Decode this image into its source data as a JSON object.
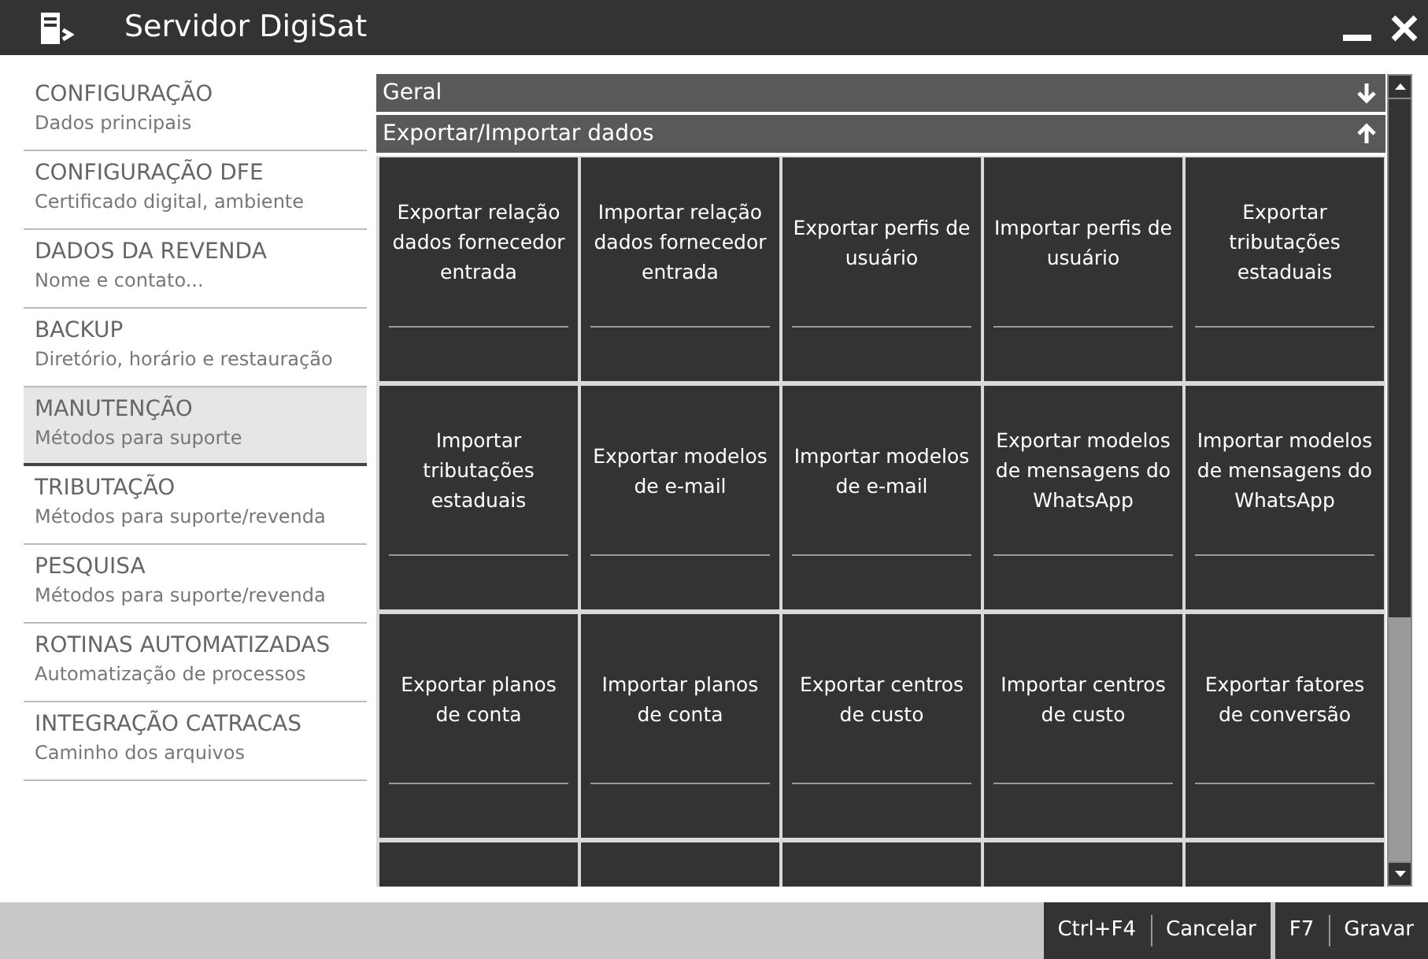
{
  "window": {
    "title": "Servidor DigiSat"
  },
  "sidebar": {
    "items": [
      {
        "title": "CONFIGURAÇÃO",
        "subtitle": "Dados principais",
        "selected": false
      },
      {
        "title": "CONFIGURAÇÃO DFE",
        "subtitle": "Certificado digital, ambiente",
        "selected": false
      },
      {
        "title": "DADOS DA REVENDA",
        "subtitle": "Nome e contato...",
        "selected": false
      },
      {
        "title": "BACKUP",
        "subtitle": "Diretório, horário e restauração",
        "selected": false
      },
      {
        "title": "MANUTENÇÃO",
        "subtitle": "Métodos para suporte",
        "selected": true
      },
      {
        "title": "TRIBUTAÇÃO",
        "subtitle": "Métodos para suporte/revenda",
        "selected": false
      },
      {
        "title": "PESQUISA",
        "subtitle": "Métodos para suporte/revenda",
        "selected": false
      },
      {
        "title": "ROTINAS AUTOMATIZADAS",
        "subtitle": "Automatização de processos",
        "selected": false
      },
      {
        "title": "INTEGRAÇÃO CATRACAS",
        "subtitle": "Caminho dos arquivos",
        "selected": false
      }
    ]
  },
  "sections": [
    {
      "title": "Geral",
      "expanded": false
    },
    {
      "title": "Exportar/Importar dados",
      "expanded": true,
      "tiles": [
        {
          "kind": "tile",
          "label": "Exportar relação dados fornecedor entrada"
        },
        {
          "kind": "tile",
          "label": "Importar relação dados fornecedor entrada"
        },
        {
          "kind": "tile",
          "label": "Exportar perfis de usuário"
        },
        {
          "kind": "tile",
          "label": "Importar perfis de usuário"
        },
        {
          "kind": "tile",
          "label": "Exportar tributações estaduais"
        },
        {
          "kind": "tile",
          "label": "Importar tributações estaduais"
        },
        {
          "kind": "tile",
          "label": "Exportar modelos de e-mail"
        },
        {
          "kind": "tile",
          "label": "Importar modelos de e-mail"
        },
        {
          "kind": "tile",
          "label": "Exportar modelos de mensagens do WhatsApp"
        },
        {
          "kind": "tile",
          "label": "Importar modelos de mensagens do WhatsApp"
        },
        {
          "kind": "tile",
          "label": "Exportar planos de conta"
        },
        {
          "kind": "tile",
          "label": "Importar planos de conta"
        },
        {
          "kind": "tile",
          "label": "Exportar centros de custo"
        },
        {
          "kind": "tile",
          "label": "Importar centros de custo"
        },
        {
          "kind": "tile",
          "label": "Exportar fatores de conversão"
        },
        {
          "kind": "cut"
        },
        {
          "kind": "cut"
        },
        {
          "kind": "cut"
        },
        {
          "kind": "cut"
        },
        {
          "kind": "cut"
        }
      ]
    }
  ],
  "footer": {
    "buttons": [
      {
        "shortcut": "Ctrl+F4",
        "label": "Cancelar"
      },
      {
        "shortcut": "F7",
        "label": "Gravar"
      }
    ]
  }
}
